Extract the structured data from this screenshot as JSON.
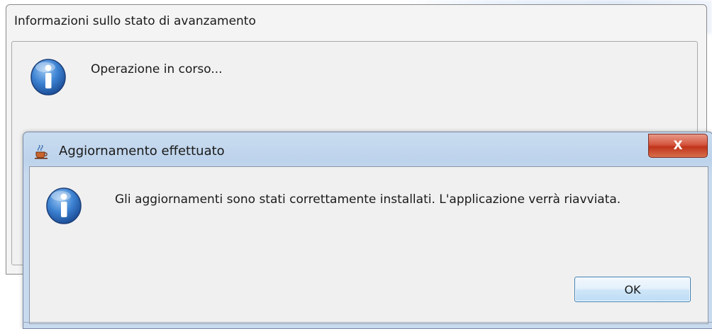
{
  "progress_dialog": {
    "title": "Informazioni sullo stato di avanzamento",
    "message": "Operazione in corso...",
    "icon": "info-icon"
  },
  "update_dialog": {
    "title": "Aggiornamento effettuato",
    "title_icon": "java-cup-icon",
    "close_label": "X",
    "message": "Gli aggiornamenti sono stati correttamente installati. L'applicazione verrà riavviata.",
    "icon": "info-icon",
    "ok_label": "OK"
  },
  "colors": {
    "info_icon_blue": "#2a6fc4",
    "close_red": "#c8402a",
    "titlebar_blue": "#c3d7ee"
  }
}
